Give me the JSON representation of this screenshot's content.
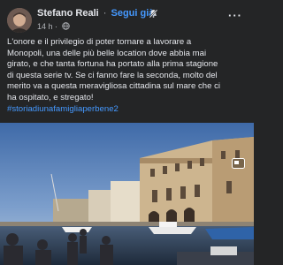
{
  "post": {
    "author": "Stefano Reali",
    "separator": "·",
    "follow_label": "Segui già",
    "time": "14 h",
    "time_separator": "·",
    "more_label": "···",
    "icons": {
      "avatar": "avatar-photo",
      "notification": "bell-muted-icon",
      "audience": "globe-icon",
      "more": "more-options-icon",
      "photo_overlay": "media-icon"
    },
    "text_lines": [
      "L'onore e il privilegio di poter tornare a lavorare a",
      "Monopoli, una delle più belle location dove abbia mai",
      "girato, e che tanta fortuna ha portato alla prima stagione",
      "di questa serie tv.  Se ci fanno fare la seconda, molto del",
      "merito va a questa meravigliosa cittadina sul mare che ci",
      "ha ospitato, e stregato!"
    ],
    "hashtag": "#storiadiunafamigliaperbene2"
  },
  "colors": {
    "background": "#242526",
    "text": "#e4e6eb",
    "secondary": "#b0b3b8",
    "link": "#4599ff"
  }
}
